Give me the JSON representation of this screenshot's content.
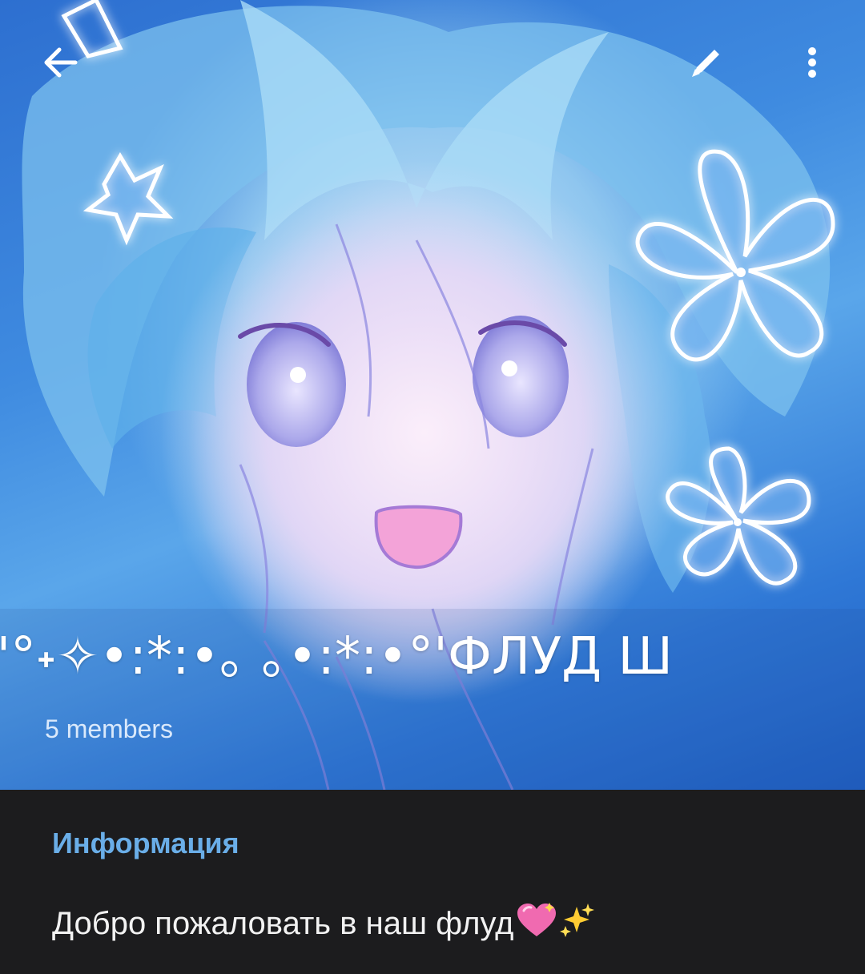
{
  "header": {
    "title": "\\'°˖✧•:*:•｡ ｡•:*:•°'ФЛУД Ш",
    "members": "5 members"
  },
  "toolbar": {
    "back_icon": "arrow-left-icon",
    "edit_icon": "pencil-icon",
    "more_icon": "vertical-dots-icon"
  },
  "info": {
    "heading": "Информация",
    "description": "Добро пожаловать в наш флуд",
    "description_emojis": [
      "sparkling-heart-emoji",
      "sparkles-emoji"
    ]
  },
  "colors": {
    "background": "#1c1c1e",
    "accent": "#6aaee8",
    "text": "#f2f2f2",
    "cover_blue": "#2f78d6"
  }
}
